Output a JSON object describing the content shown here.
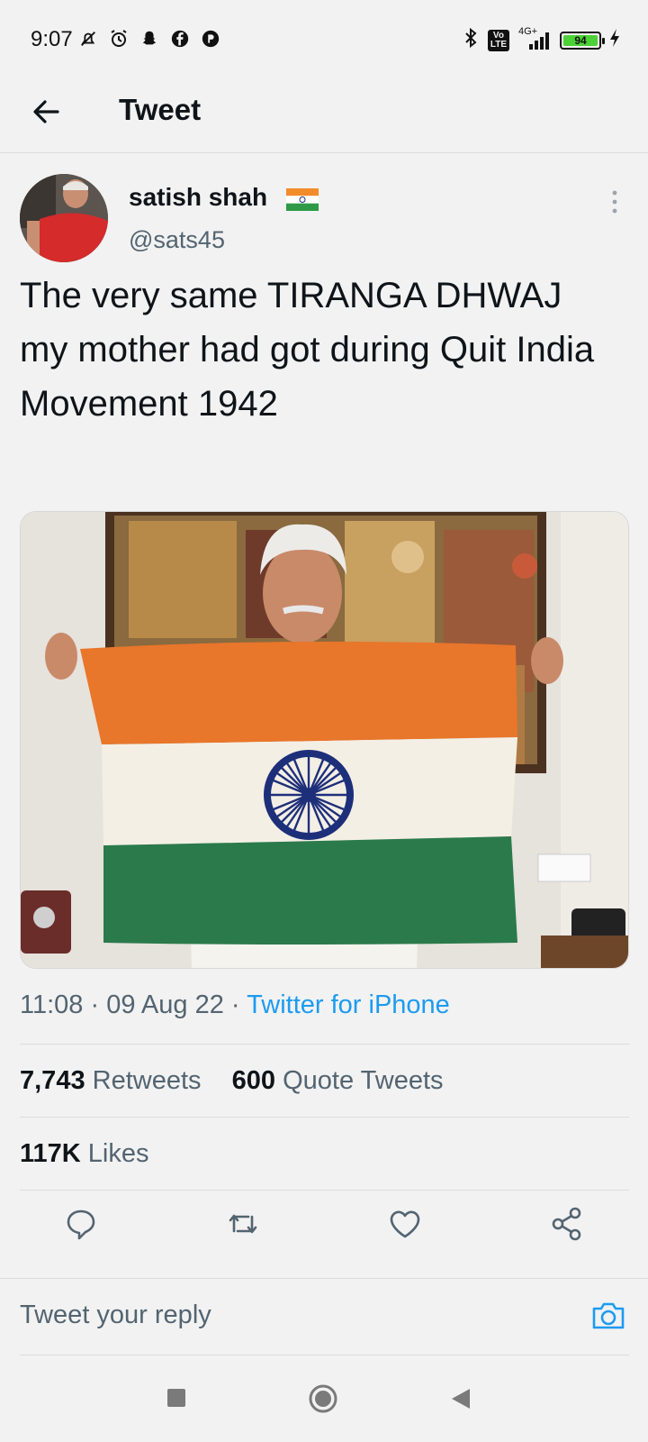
{
  "status_bar": {
    "time": "9:07",
    "network": "4G+",
    "volte": "Vo\nLTE",
    "battery": "94",
    "left_icons": [
      "mute-icon",
      "alarm-icon",
      "snapchat-icon",
      "facebook-icon",
      "app-icon"
    ],
    "right_icons": [
      "bluetooth-icon",
      "volte-icon",
      "signal-icon",
      "battery-icon",
      "charging-icon"
    ]
  },
  "header": {
    "title": "Tweet"
  },
  "tweet": {
    "author_name": "satish shah",
    "handle": "@sats45",
    "text": "The very same TIRANGA DHWAJ my mother had got during Quit India Movement 1942",
    "time": "11:08",
    "date": "09 Aug 22",
    "source": "Twitter for iPhone",
    "separator": "·"
  },
  "stats": {
    "retweets_count": "7,743",
    "retweets_label": "Retweets",
    "quotes_count": "600",
    "quotes_label": "Quote Tweets",
    "likes_count": "117K",
    "likes_label": "Likes"
  },
  "reply": {
    "placeholder": "Tweet your reply"
  },
  "colors": {
    "accent": "#1d9bf0",
    "saffron": "#e8762b",
    "green": "#2b7a4b",
    "chakra": "#1e2f7a"
  }
}
